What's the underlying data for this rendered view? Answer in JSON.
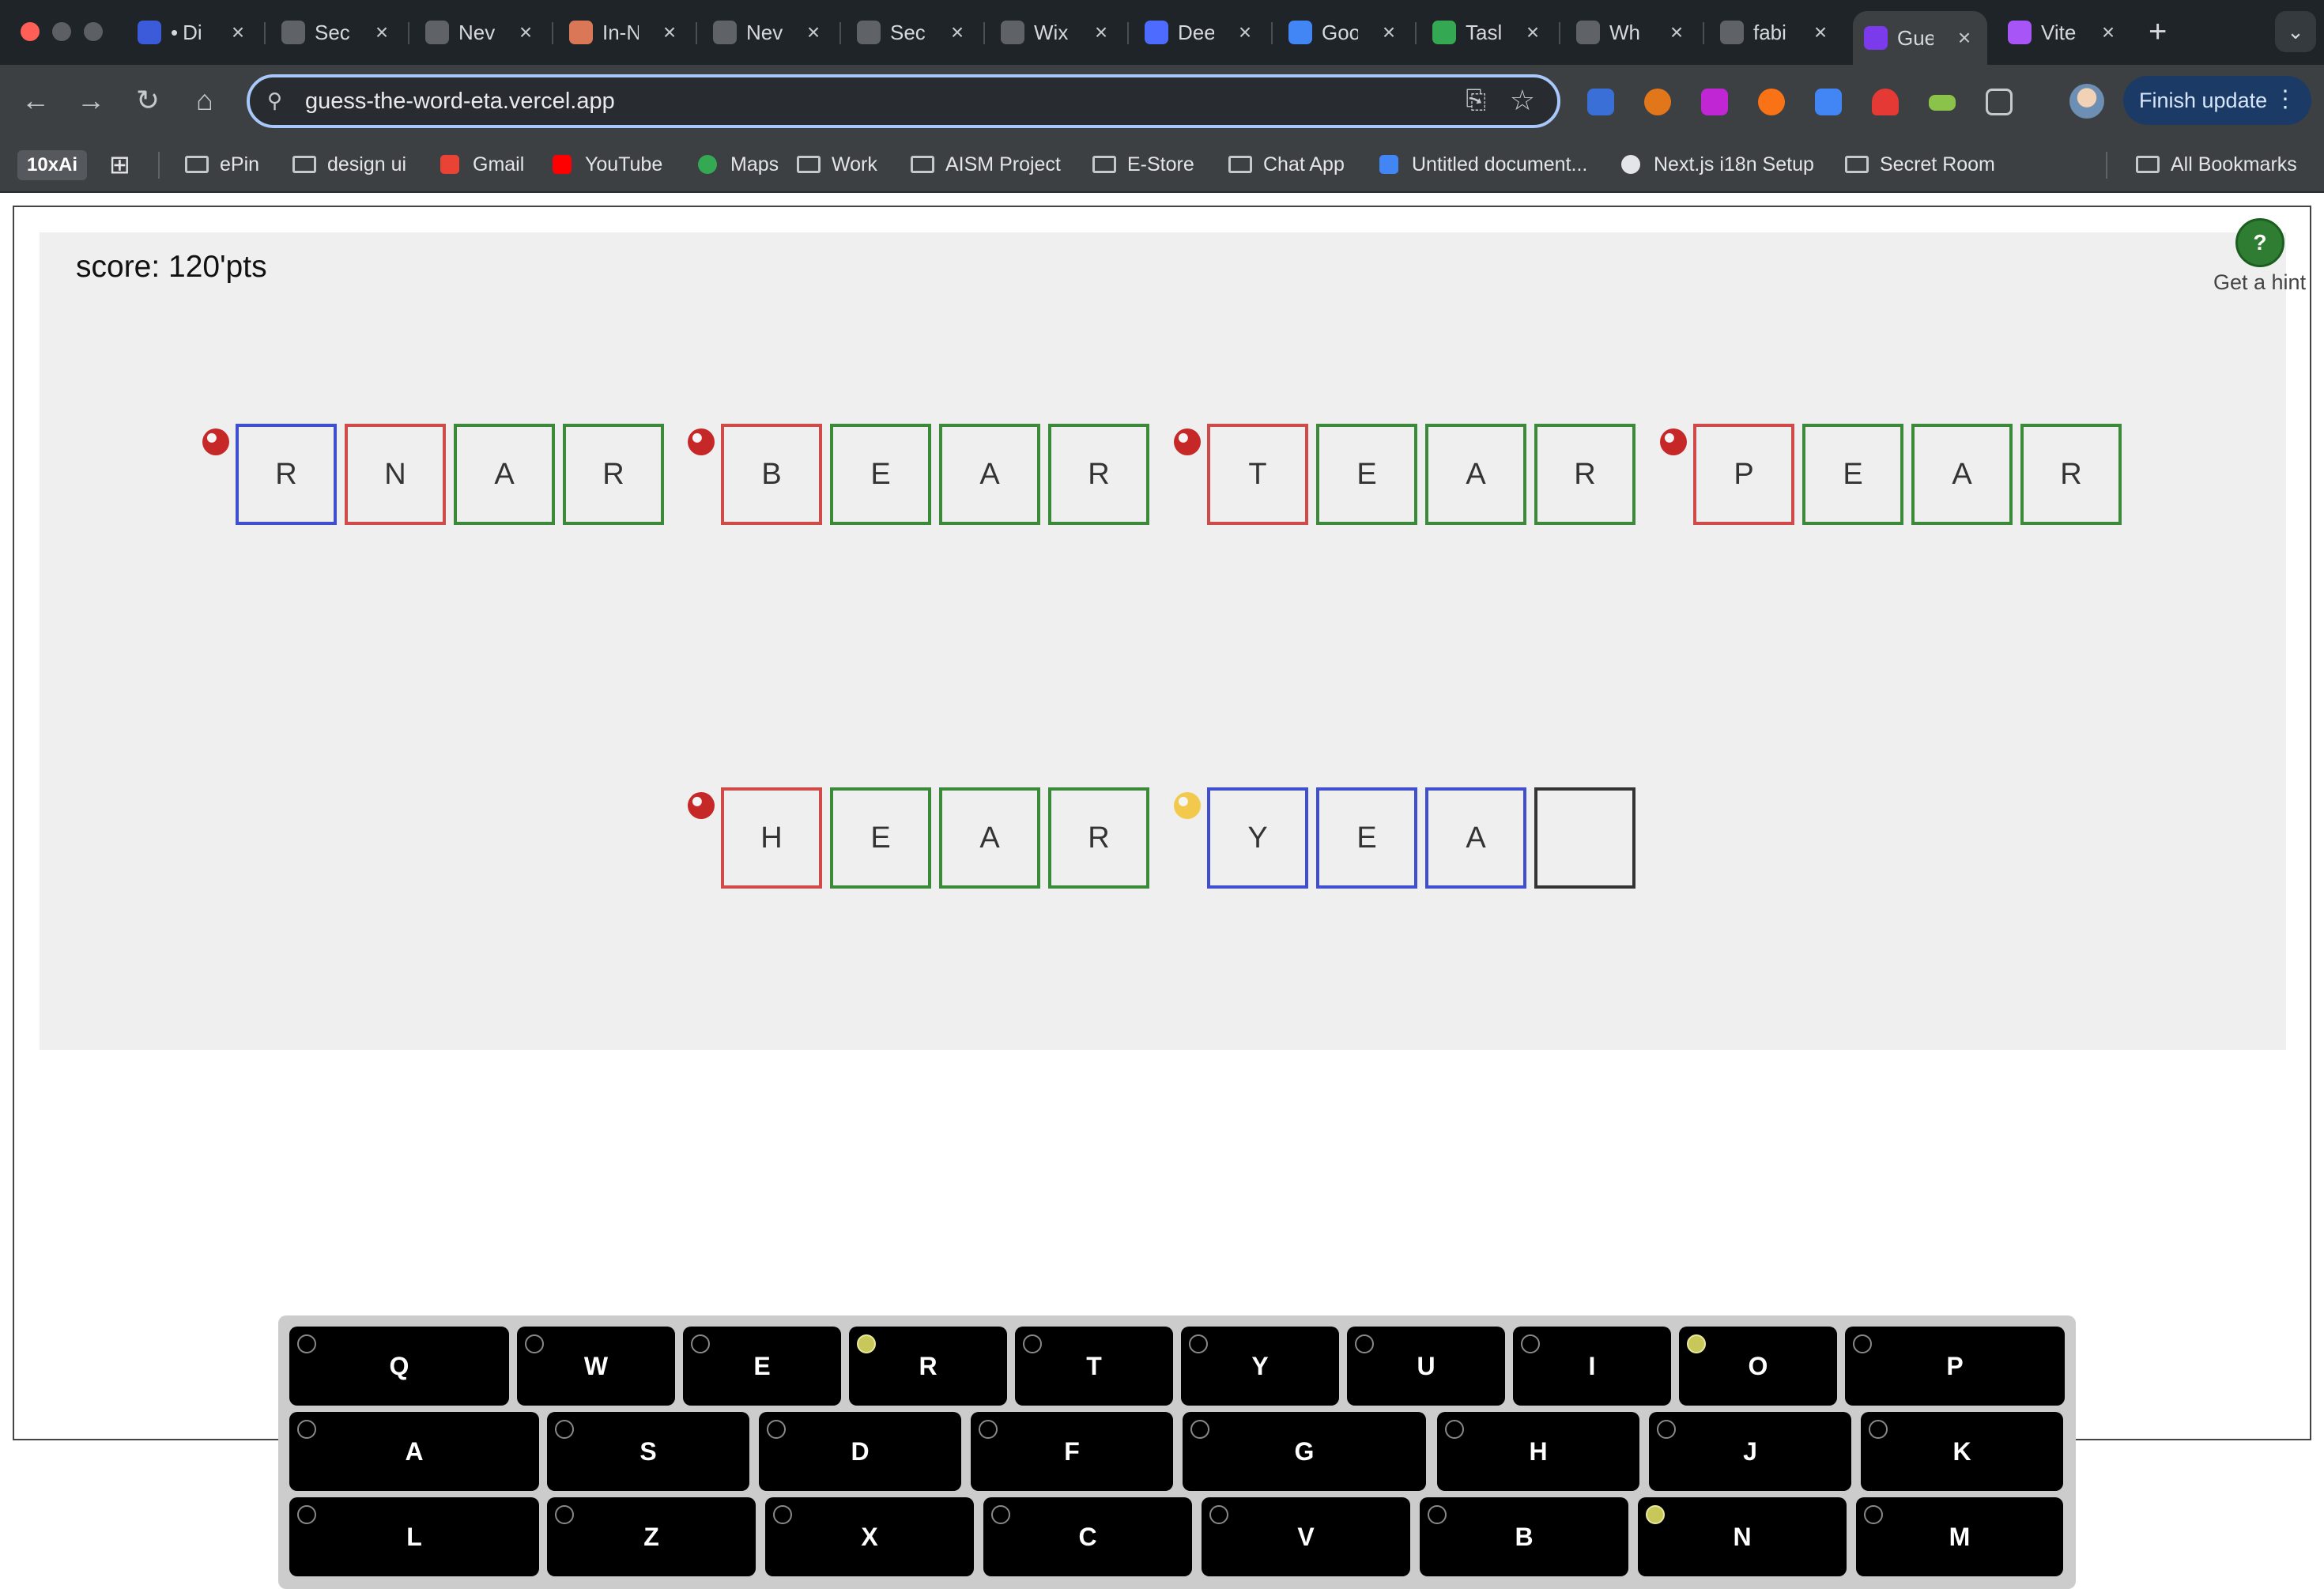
{
  "browser": {
    "tabs": [
      {
        "label": "Di",
        "prefix": "•",
        "icon": "gemini-avatar-icon",
        "color": "#3b5bdb"
      },
      {
        "label": "Sec",
        "icon": "globe-icon",
        "color": "#5f6368"
      },
      {
        "label": "Nev",
        "icon": "copilot-icon",
        "color": "#5f6368"
      },
      {
        "label": "In-N",
        "icon": "claude-asterisk-icon",
        "color": "#d97757"
      },
      {
        "label": "Nev",
        "icon": "copilot-icon",
        "color": "#5f6368"
      },
      {
        "label": "Sec",
        "icon": "globe-icon",
        "color": "#5f6368"
      },
      {
        "label": "Wix",
        "icon": "openai-icon",
        "color": "#5f6368"
      },
      {
        "label": "Dee",
        "icon": "deepseek-whale-icon",
        "color": "#4d6bfe"
      },
      {
        "label": "Goo",
        "icon": "gemini-sparkle-icon",
        "color": "#4285f4"
      },
      {
        "label": "Tasl",
        "icon": "tasks-plus-icon",
        "color": "#34a853"
      },
      {
        "label": "Wh",
        "icon": "copilot-icon",
        "color": "#5f6368"
      },
      {
        "label": "fabi",
        "icon": "github-icon",
        "color": "#5f6368"
      },
      {
        "label": "Gue",
        "icon": "purple-hex-icon",
        "color": "#7c3aed",
        "active": true
      },
      {
        "label": "Vite",
        "icon": "vite-icon",
        "color": "#a855f7"
      }
    ],
    "url": "guess-the-word-eta.vercel.app",
    "finish_update": "Finish update",
    "bookmarks": [
      {
        "label": "ePin",
        "icon": "folder-icon"
      },
      {
        "label": "design ui",
        "icon": "folder-icon"
      },
      {
        "label": "Gmail",
        "icon": "gmail-icon"
      },
      {
        "label": "YouTube",
        "icon": "youtube-icon"
      },
      {
        "label": "Maps",
        "icon": "maps-pin-icon"
      },
      {
        "label": "Work",
        "icon": "folder-icon"
      },
      {
        "label": "AISM Project",
        "icon": "folder-icon"
      },
      {
        "label": "E-Store",
        "icon": "folder-icon"
      },
      {
        "label": "Chat App",
        "icon": "folder-icon"
      },
      {
        "label": "Untitled document...",
        "icon": "docs-icon"
      },
      {
        "label": "Next.js i18n Setup",
        "icon": "openai-icon"
      },
      {
        "label": "Secret Room",
        "icon": "folder-icon"
      }
    ],
    "bookmark_10x": "10xAi",
    "all_bookmarks": "All Bookmarks"
  },
  "game": {
    "score_text": "score: 120'pts",
    "hint_symbol": "?",
    "hint_label": "Get a hint",
    "colors": {
      "correct": "#3a8a3a",
      "present": "#d04a4a",
      "blue": "#3f4fd0",
      "empty": "#333333",
      "dot_red": "#c62828",
      "dot_yellow": "#f2c94c"
    },
    "guesses": [
      {
        "dot": "red",
        "letters": [
          "R",
          "N",
          "A",
          "R"
        ],
        "states": [
          "blue",
          "present",
          "correct",
          "correct"
        ]
      },
      {
        "dot": "red",
        "letters": [
          "B",
          "E",
          "A",
          "R"
        ],
        "states": [
          "present",
          "correct",
          "correct",
          "correct"
        ]
      },
      {
        "dot": "red",
        "letters": [
          "T",
          "E",
          "A",
          "R"
        ],
        "states": [
          "present",
          "correct",
          "correct",
          "correct"
        ]
      },
      {
        "dot": "red",
        "letters": [
          "P",
          "E",
          "A",
          "R"
        ],
        "states": [
          "present",
          "correct",
          "correct",
          "correct"
        ]
      },
      {
        "dot": "red",
        "letters": [
          "H",
          "E",
          "A",
          "R"
        ],
        "states": [
          "present",
          "correct",
          "correct",
          "correct"
        ]
      },
      {
        "dot": "yellow",
        "letters": [
          "Y",
          "E",
          "A",
          ""
        ],
        "states": [
          "blue",
          "blue",
          "blue",
          "empty"
        ]
      }
    ]
  },
  "keyboard": {
    "rows": [
      [
        {
          "key": "Q",
          "lit": false
        },
        {
          "key": "W",
          "lit": false
        },
        {
          "key": "E",
          "lit": false
        },
        {
          "key": "R",
          "lit": true
        },
        {
          "key": "T",
          "lit": false
        },
        {
          "key": "Y",
          "lit": false
        },
        {
          "key": "U",
          "lit": false
        },
        {
          "key": "I",
          "lit": false
        },
        {
          "key": "O",
          "lit": true
        },
        {
          "key": "P",
          "lit": false
        }
      ],
      [
        {
          "key": "A",
          "lit": false
        },
        {
          "key": "S",
          "lit": false
        },
        {
          "key": "D",
          "lit": false
        },
        {
          "key": "F",
          "lit": false
        },
        {
          "key": "G",
          "lit": false
        },
        {
          "key": "H",
          "lit": false
        },
        {
          "key": "J",
          "lit": false
        },
        {
          "key": "K",
          "lit": false
        }
      ],
      [
        {
          "key": "L",
          "lit": false
        },
        {
          "key": "Z",
          "lit": false
        },
        {
          "key": "X",
          "lit": false
        },
        {
          "key": "C",
          "lit": false
        },
        {
          "key": "V",
          "lit": false
        },
        {
          "key": "B",
          "lit": false
        },
        {
          "key": "N",
          "lit": true
        },
        {
          "key": "M",
          "lit": false
        }
      ]
    ],
    "lit_color": "#c8c85a"
  }
}
